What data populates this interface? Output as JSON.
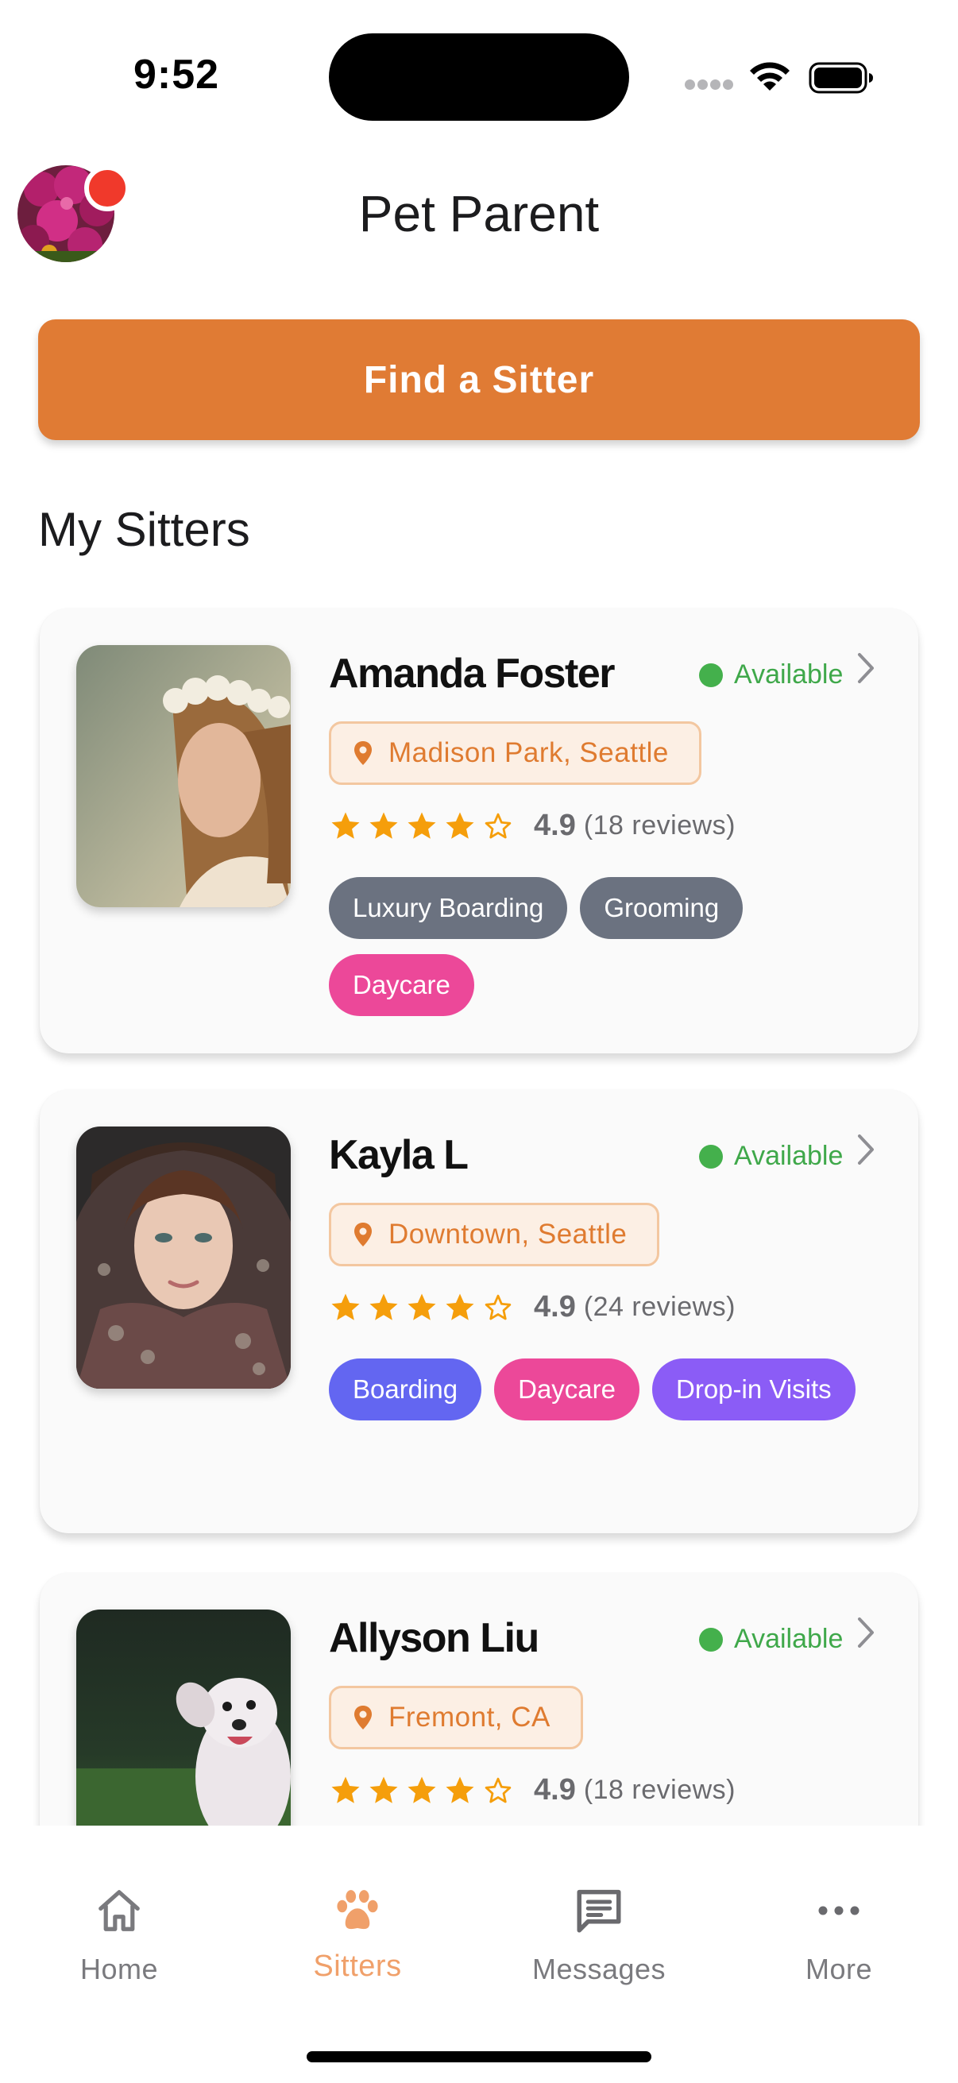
{
  "status_bar": {
    "time": "9:52"
  },
  "header": {
    "title": "Pet Parent",
    "find_sitter_label": "Find a Sitter"
  },
  "section": {
    "title": "My Sitters"
  },
  "sitters": [
    {
      "name": "Amanda Foster",
      "status": "Available",
      "location": "Madison Park, Seattle",
      "rating": "4.9",
      "reviews": "(18 reviews)",
      "stars_filled": 4,
      "tags": [
        {
          "label": "Luxury Boarding",
          "color": "#6b7280"
        },
        {
          "label": "Grooming",
          "color": "#6b7280"
        },
        {
          "label": "Daycare",
          "color": "#ec4899"
        }
      ]
    },
    {
      "name": "Kayla L",
      "status": "Available",
      "location": "Downtown, Seattle",
      "rating": "4.9",
      "reviews": "(24 reviews)",
      "stars_filled": 4,
      "tags": [
        {
          "label": "Boarding",
          "color": "#6366f1"
        },
        {
          "label": "Daycare",
          "color": "#ec4899"
        },
        {
          "label": "Drop-in Visits",
          "color": "#8b5cf6"
        }
      ]
    },
    {
      "name": "Allyson Liu",
      "status": "Available",
      "location": "Fremont, CA",
      "rating": "4.9",
      "reviews": "(18 reviews)",
      "stars_filled": 4,
      "tags": []
    }
  ],
  "nav": {
    "items": [
      {
        "label": "Home",
        "icon": "home-icon"
      },
      {
        "label": "Sitters",
        "icon": "paw-icon",
        "active": true
      },
      {
        "label": "Messages",
        "icon": "message-icon"
      },
      {
        "label": "More",
        "icon": "more-icon"
      }
    ]
  },
  "colors": {
    "accent": "#e07b34",
    "available": "#44b04c",
    "star": "#f59e0b",
    "notification": "#f0392b"
  }
}
